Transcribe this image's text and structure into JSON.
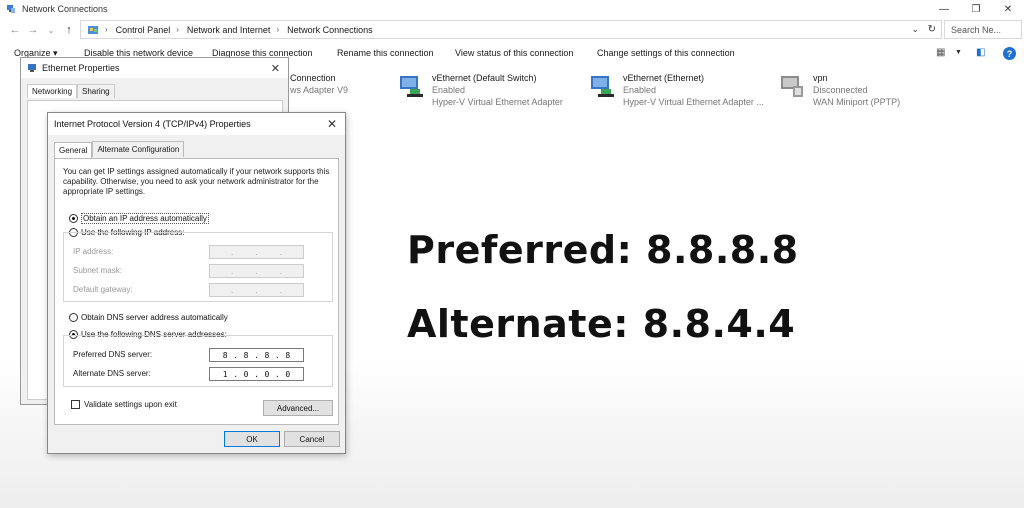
{
  "window": {
    "title": "Network Connections",
    "controls": [
      "—",
      "❐",
      "✕"
    ]
  },
  "address": {
    "crumbs": [
      "Control Panel",
      "Network and Internet",
      "Network Connections"
    ],
    "search_placeholder": "Search Ne..."
  },
  "commands": [
    "Organize ▾",
    "Disable this network device",
    "Diagnose this connection",
    "Rename this connection",
    "View status of this connection",
    "Change settings of this connection"
  ],
  "connections": [
    {
      "name": "Connection",
      "status": "",
      "adapter": "ws Adapter V9"
    },
    {
      "name": "vEthernet (Default Switch)",
      "status": "Enabled",
      "adapter": "Hyper-V Virtual Ethernet Adapter"
    },
    {
      "name": "vEthernet (Ethernet)",
      "status": "Enabled",
      "adapter": "Hyper-V Virtual Ethernet Adapter ..."
    },
    {
      "name": "vpn",
      "status": "Disconnected",
      "adapter": "WAN Miniport (PPTP)"
    }
  ],
  "overlay": {
    "preferred": "Preferred: 8.8.8.8",
    "alternate": "Alternate: 8.8.4.4"
  },
  "eth_dialog": {
    "title": "Ethernet Properties",
    "tabs": [
      "Networking",
      "Sharing"
    ],
    "close": "✕"
  },
  "ipv4_dialog": {
    "title": "Internet Protocol Version 4 (TCP/IPv4) Properties",
    "close": "✕",
    "tabs": [
      "General",
      "Alternate Configuration"
    ],
    "intro": "You can get IP settings assigned automatically if your network supports this capability. Otherwise, you need to ask your network administrator for the appropriate IP settings.",
    "obtain_ip_auto": "Obtain an IP address automatically",
    "use_following_ip": "Use the following IP address:",
    "ip_address_label": "IP address:",
    "subnet_label": "Subnet mask:",
    "gateway_label": "Default gateway:",
    "obtain_dns_auto": "Obtain DNS server address automatically",
    "use_following_dns": "Use the following DNS server addresses:",
    "preferred_dns_label": "Preferred DNS server:",
    "alternate_dns_label": "Alternate DNS server:",
    "preferred_dns": [
      "8",
      "8",
      "8",
      "8"
    ],
    "alternate_dns": [
      "1",
      "0",
      "0",
      "0"
    ],
    "validate_label": "Validate settings upon exit",
    "advanced_label": "Advanced...",
    "ok_label": "OK",
    "cancel_label": "Cancel"
  }
}
